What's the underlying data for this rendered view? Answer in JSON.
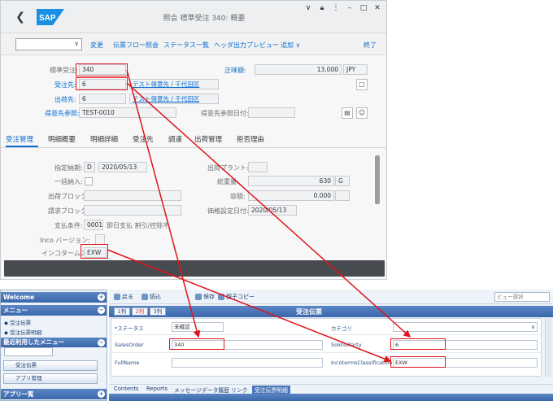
{
  "sap": {
    "title": "照会 標準受注 340: 概要",
    "logo": "SAP",
    "toolbar": {
      "items": [
        "変更",
        "伝票フロー照会",
        "ステータス一覧",
        "ヘッダ出力プレビュー",
        "追加 ∨",
        "終了"
      ]
    },
    "header": {
      "order_type_label": "標準受注:",
      "order_type_value": "340",
      "net_value_label": "正味額:",
      "net_value": "13,000",
      "currency": "JPY",
      "sold_to_label": "受注先:",
      "sold_to_value": "6",
      "sold_to_name": "テスト得意先 / 千代田区",
      "ship_to_label": "出荷先:",
      "ship_to_value": "6",
      "ship_to_name": "テスト得意先 / 千代田区",
      "customer_ref_label": "得意先参照:",
      "customer_ref_value": "TEST-0010",
      "customer_ref_date_label": "得意先参照日付:"
    },
    "tabs": [
      "受注管理",
      "明細概要",
      "明細詳細",
      "受注先",
      "調達",
      "出荷管理",
      "拒否理由"
    ],
    "panel": {
      "req_deliv_label": "指定納期:",
      "req_deliv_type": "D",
      "req_deliv_date": "2020/05/13",
      "deliv_plant_label": "出荷プラント:",
      "complete_deliv_label": "一括納入:",
      "total_weight_label": "総重量:",
      "total_weight_value": "630",
      "total_weight_unit": "G",
      "deliv_block_label": "出荷ブロック:",
      "volume_label": "容積:",
      "volume_value": "0.000",
      "billing_block_label": "請求ブロック:",
      "pricing_date_label": "価格設定日付:",
      "pricing_date_value": "2020/05/13",
      "payment_terms_label": "支払条件:",
      "payment_terms_value": "0001",
      "payment_terms_text": "即日支払 割引/控除不",
      "inco_version_label": "Inco バージョン:",
      "incoterms_label": "インコタームズ:",
      "incoterms_value": "EXW"
    }
  },
  "app": {
    "left": {
      "welcome": "Welcome",
      "menu_header": "メニュー",
      "menu_items": [
        "受注伝票",
        "受注伝票明細"
      ],
      "recent_header": "最近利用したメニュー",
      "recent_items": [
        "受注伝票",
        "アプリ管理"
      ],
      "apps_header": "アプリ一覧"
    },
    "toolbar": {
      "back": "戻る",
      "reload": "読込",
      "save": "保存",
      "copy": "親子コピー",
      "view_select": "ビュー選択"
    },
    "columns": [
      "1列",
      "2列",
      "3列"
    ],
    "form_title": "受注伝票",
    "form": {
      "status_label": "*ステータス",
      "status_value": "未確認",
      "category_label": "カテゴリ",
      "sales_order_label": "SalesOrder",
      "sales_order_value": "340",
      "sold_to_party_label": "SoldToParty",
      "sold_to_party_value": "6",
      "full_name_label": "FullName",
      "incoterms_label": "IncotermsClassification",
      "incoterms_value": "EXW"
    },
    "bottom_tabs": [
      "Contents",
      "Reports",
      "メッセージ",
      "データ履歴",
      "リンク",
      "受注伝票明細"
    ]
  },
  "colors": {
    "highlight": "#e0151b",
    "sap_blue": "#0a6ed1",
    "app_header": "#3a67ab"
  }
}
